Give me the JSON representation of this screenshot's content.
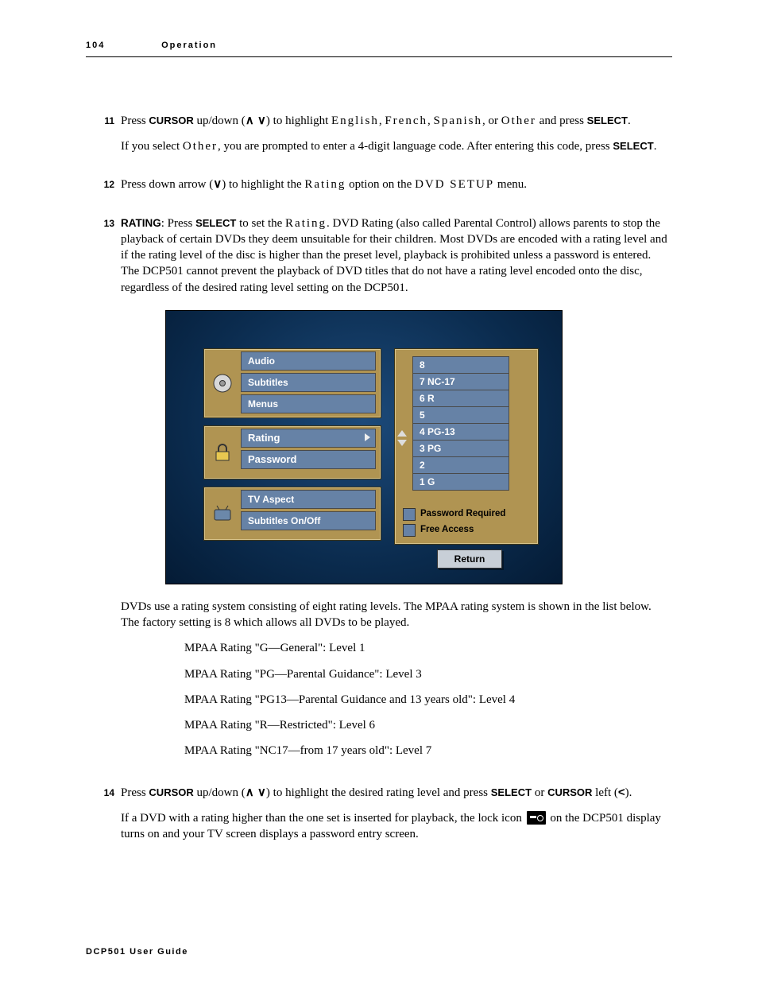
{
  "header": {
    "page": "104",
    "title": "Operation"
  },
  "step11": {
    "num": "11",
    "p1_a": "Press ",
    "p1_b": "CURSOR",
    "p1_c": " up/down (",
    "arrows": "∧ ∨",
    "p1_d": ") to highlight ",
    "opt_en": "English",
    "comma1": ", ",
    "opt_fr": "French",
    "comma2": ", ",
    "opt_es": "Spanish",
    "comma3": ", or ",
    "opt_other": "Other",
    "p1_e": " and press ",
    "p1_f": "SELECT",
    "p1_g": ".",
    "p2_a": "If you select ",
    "p2_b": "Other",
    "p2_c": ", you are prompted to enter a 4-digit language code. After entering this code, press ",
    "p2_d": "SELECT",
    "p2_e": "."
  },
  "step12": {
    "num": "12",
    "a": "Press down arrow (",
    "arrow": "∨",
    "b": ") to highlight the ",
    "rating": "Rating",
    "c": " option on the ",
    "menu": "DVD SETUP",
    "d": " menu."
  },
  "step13": {
    "num": "13",
    "label": "RATING",
    "a": ": Press ",
    "sel": "SELECT",
    "b": " to set the ",
    "rating": "Rating",
    "c": ". DVD Rating (also called Parental Control) allows parents to stop the playback of certain DVDs they deem unsuitable for their children. Most DVDs are encoded with a rating level and if the rating level of the disc is higher than the preset level, playback is prohibited unless a password is entered. The DCP501 cannot prevent the playback of DVD titles that do not have a rating level encoded onto the disc, regardless of the desired rating level setting on the DCP501.",
    "after_a": "DVDs use a rating system consisting of eight rating levels. The MPAA rating system is shown in the list below. The factory setting is 8 which allows all DVDs to be played.",
    "mpaa": [
      "MPAA Rating \"G—General\": Level 1",
      "MPAA Rating \"PG—Parental Guidance\": Level 3",
      "MPAA Rating \"PG13—Parental Guidance and 13 years old\": Level 4",
      "MPAA Rating \"R—Restricted\": Level 6",
      "MPAA Rating \"NC17—from 17 years old\": Level 7"
    ]
  },
  "step14": {
    "num": "14",
    "a": "Press ",
    "cursor": "CURSOR",
    "b": " up/down (",
    "arrows": "∧ ∨",
    "c": ") to highlight the desired rating level and press ",
    "sel": "SELECT",
    "d": " or ",
    "cursor2": "CURSOR",
    "e": " left (",
    "lt": "<",
    "f": ").",
    "p2_a": "If a DVD with a rating higher than the one set is inserted for playback, the lock icon ",
    "p2_b": " on the DCP501 display turns on and your TV screen displays a password entry screen."
  },
  "ui": {
    "left_a": [
      "Audio",
      "Subtitles",
      "Menus"
    ],
    "left_b": [
      "Rating",
      "Password"
    ],
    "left_c": [
      "TV Aspect",
      "Subtitles On/Off"
    ],
    "ratings": [
      "8",
      "7 NC-17",
      "6 R",
      "5",
      "4 PG-13",
      "3 PG",
      "2",
      "1 G"
    ],
    "legend": [
      "Password Required",
      "Free Access"
    ],
    "return": "Return"
  },
  "footer": "DCP501 User Guide"
}
